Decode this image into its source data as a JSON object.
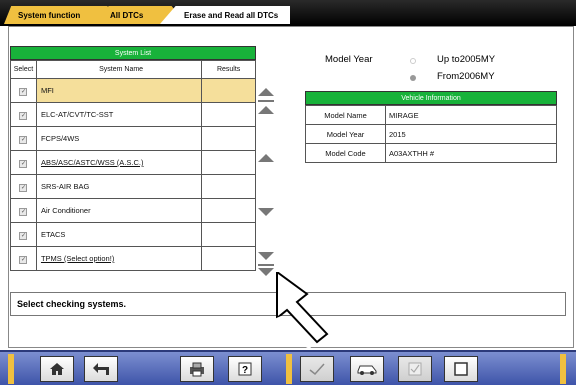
{
  "tabs": [
    {
      "label": "System function"
    },
    {
      "label": "All DTCs"
    },
    {
      "label": "Erase and Read all DTCs"
    }
  ],
  "system_list": {
    "title": "System List",
    "headers": {
      "select": "Select",
      "name": "System Name",
      "results": "Results"
    },
    "rows": [
      {
        "name": "MFI",
        "checked": true,
        "underline": false
      },
      {
        "name": "ELC-AT/CVT/TC-SST",
        "checked": true,
        "underline": false
      },
      {
        "name": "FCPS/4WS",
        "checked": true,
        "underline": false
      },
      {
        "name": "ABS/ASC/ASTC/WSS (A.S.C.)",
        "checked": true,
        "underline": true
      },
      {
        "name": "SRS-AIR BAG",
        "checked": true,
        "underline": false
      },
      {
        "name": "Air Conditioner",
        "checked": true,
        "underline": false
      },
      {
        "name": "ETACS",
        "checked": true,
        "underline": false
      },
      {
        "name": "TPMS (Select option!)",
        "checked": true,
        "underline": true
      }
    ]
  },
  "model_year": {
    "label": "Model Year",
    "option1": "Up to2005MY",
    "option2": "From2006MY",
    "selected": "From2006MY"
  },
  "vehicle_info": {
    "title": "Vehicle Information",
    "rows": [
      {
        "key": "Model Name",
        "value": "MIRAGE"
      },
      {
        "key": "Model Year",
        "value": "2015"
      },
      {
        "key": "Model Code",
        "value": "A03AXTHH #"
      }
    ]
  },
  "status_text": "Select checking systems.",
  "toolbar": {
    "icons": [
      "home-icon",
      "back-icon",
      "print-icon",
      "help-icon",
      "check-icon",
      "vehicle-icon",
      "checkbox-checked-icon",
      "checkbox-empty-icon"
    ]
  },
  "colors": {
    "accent_green": "#18b23a",
    "tab_yellow": "#f0c040",
    "toolbar_blue": "#4a5fb5"
  }
}
